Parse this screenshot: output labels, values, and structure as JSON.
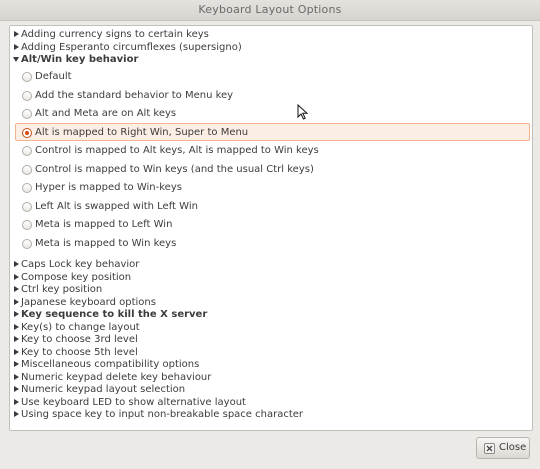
{
  "window": {
    "title": "Keyboard Layout Options"
  },
  "groups_top": [
    {
      "label": "Adding currency signs to certain keys",
      "expanded": false,
      "bold": false
    },
    {
      "label": "Adding Esperanto circumflexes (supersigno)",
      "expanded": false,
      "bold": false
    },
    {
      "label": "Alt/Win key behavior",
      "expanded": true,
      "bold": true
    }
  ],
  "alt_win_options": [
    {
      "label": "Default",
      "selected": false
    },
    {
      "label": "Add the standard behavior to Menu key",
      "selected": false
    },
    {
      "label": "Alt and Meta are on Alt keys",
      "selected": false
    },
    {
      "label": "Alt is mapped to Right Win, Super to Menu",
      "selected": true
    },
    {
      "label": "Control is mapped to Alt keys, Alt is mapped to Win keys",
      "selected": false
    },
    {
      "label": "Control is mapped to Win keys (and the usual Ctrl keys)",
      "selected": false
    },
    {
      "label": "Hyper is mapped to Win-keys",
      "selected": false
    },
    {
      "label": "Left Alt is swapped with Left Win",
      "selected": false
    },
    {
      "label": "Meta is mapped to Left Win",
      "selected": false
    },
    {
      "label": "Meta is mapped to Win keys",
      "selected": false
    }
  ],
  "groups_bottom": [
    {
      "label": "Caps Lock key behavior",
      "bold": false
    },
    {
      "label": "Compose key position",
      "bold": false
    },
    {
      "label": "Ctrl key position",
      "bold": false
    },
    {
      "label": "Japanese keyboard options",
      "bold": false
    },
    {
      "label": "Key sequence to kill the X server",
      "bold": true
    },
    {
      "label": "Key(s) to change layout",
      "bold": false
    },
    {
      "label": "Key to choose 3rd level",
      "bold": false
    },
    {
      "label": "Key to choose 5th level",
      "bold": false
    },
    {
      "label": "Miscellaneous compatibility options",
      "bold": false
    },
    {
      "label": "Numeric keypad delete key behaviour",
      "bold": false
    },
    {
      "label": "Numeric keypad layout selection",
      "bold": false
    },
    {
      "label": "Use keyboard LED to show alternative layout",
      "bold": false
    },
    {
      "label": "Using space key to input non-breakable space character",
      "bold": false
    }
  ],
  "buttons": {
    "close_label": "Close"
  },
  "colors": {
    "accent": "#dd4814",
    "selection_bg": "#fbeee4"
  }
}
